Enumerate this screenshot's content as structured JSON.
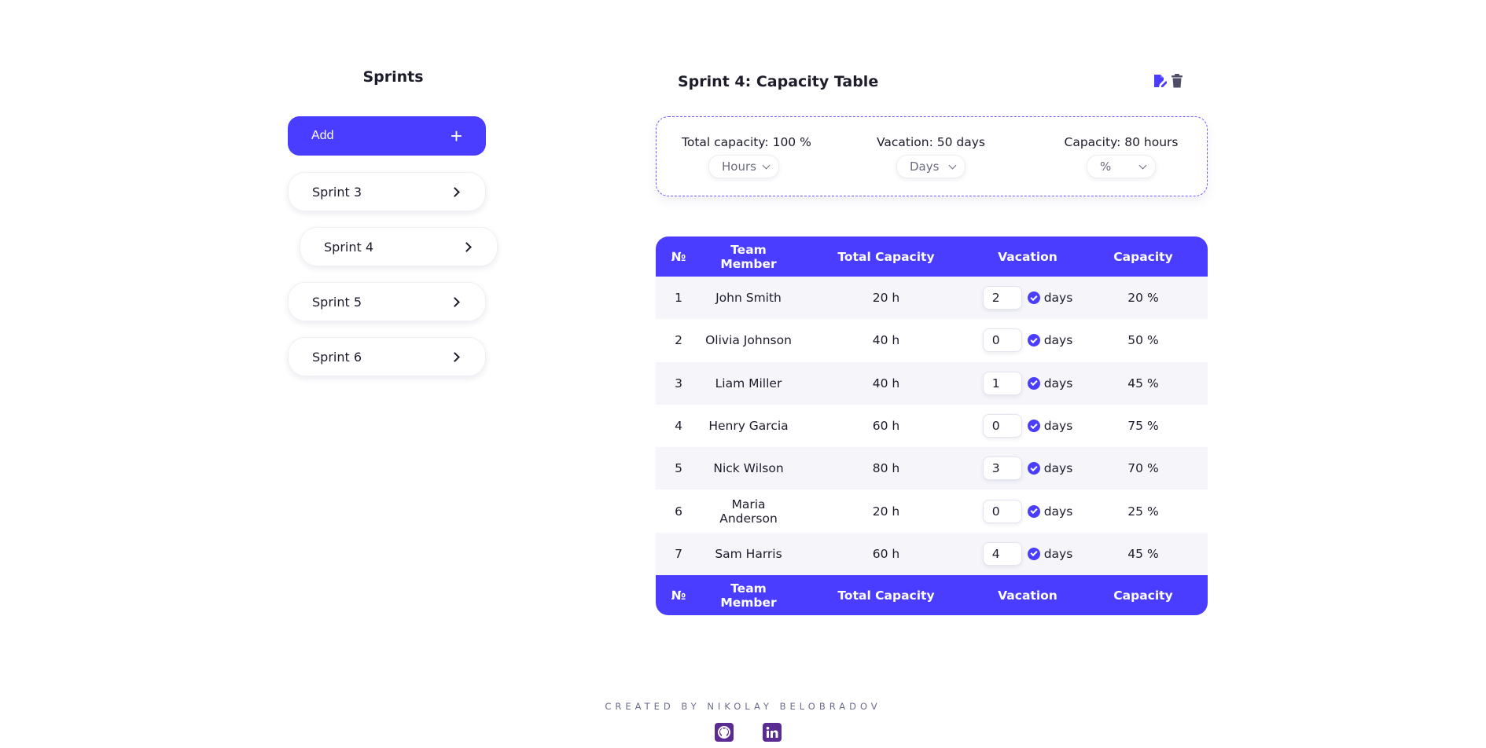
{
  "sidebar": {
    "title": "Sprints",
    "add_label": "Add",
    "add_icon": "+",
    "items": [
      {
        "label": "Sprint 3"
      },
      {
        "label": "Sprint 4"
      },
      {
        "label": "Sprint 5"
      },
      {
        "label": "Sprint 6"
      }
    ],
    "selected": "Sprint 4"
  },
  "main": {
    "title": "Sprint 4: Capacity Table",
    "summary": {
      "total_capacity": "Total capacity: 100 %",
      "vacation": "Vacation: 50 days",
      "capacity": "Capacity: 80 hours",
      "selects": [
        "Hours",
        "Days",
        "%"
      ]
    },
    "table": {
      "headers": [
        "№",
        "Team Member",
        "Total Capacity",
        "Vacation",
        "Capacity"
      ],
      "unit_label": "days",
      "rows": [
        {
          "num": "1",
          "name": "John Smith",
          "total": "20 h",
          "vacation": "2",
          "capacity": "20 %"
        },
        {
          "num": "2",
          "name": "Olivia Johnson",
          "total": "40 h",
          "vacation": "0",
          "capacity": "50 %"
        },
        {
          "num": "3",
          "name": "Liam Miller",
          "total": "40 h",
          "vacation": "1",
          "capacity": "45 %"
        },
        {
          "num": "4",
          "name": "Henry Garcia",
          "total": "60 h",
          "vacation": "0",
          "capacity": "75 %"
        },
        {
          "num": "5",
          "name": "Nick Wilson",
          "total": "80 h",
          "vacation": "3",
          "capacity": "70 %"
        },
        {
          "num": "6",
          "name": "Maria Anderson",
          "total": "20 h",
          "vacation": "0",
          "capacity": "25 %"
        },
        {
          "num": "7",
          "name": "Sam Harris",
          "total": "60 h",
          "vacation": "4",
          "capacity": "45 %"
        }
      ]
    }
  },
  "footer": {
    "credit": "CREATED BY NIKOLAY BELOBRADOV",
    "icons": [
      "github-icon",
      "linkedin-icon"
    ]
  },
  "colors": {
    "accent": "#4a3dff",
    "social": "#5a2c91",
    "row_alt": "#f5f5fa"
  }
}
